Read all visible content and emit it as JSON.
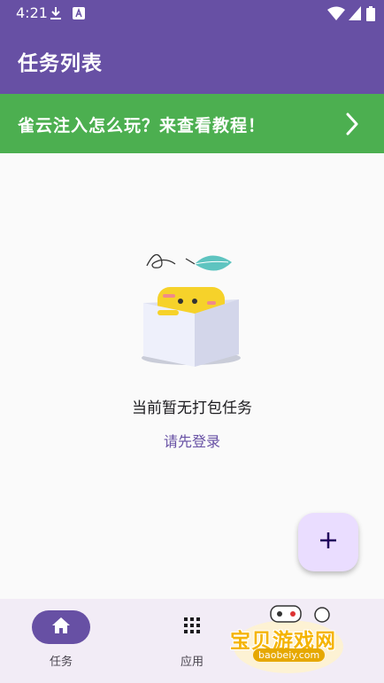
{
  "status_bar": {
    "time": "4:21",
    "icons": [
      "download-icon",
      "keyboard-a-icon",
      "wifi-icon",
      "signal-icon",
      "battery-icon"
    ]
  },
  "app_bar": {
    "title": "任务列表"
  },
  "banner": {
    "text": "雀云注入怎么玩？来查看教程！",
    "icon": "chevron-right-icon"
  },
  "empty_state": {
    "message": "当前暂无打包任务",
    "action_link": "请先登录",
    "illustration": "empty-box-illustration"
  },
  "fab": {
    "icon": "plus-icon"
  },
  "bottom_nav": {
    "items": [
      {
        "label": "任务",
        "icon": "home-icon",
        "active": true
      },
      {
        "label": "应用",
        "icon": "apps-grid-icon",
        "active": false
      }
    ]
  },
  "watermark": {
    "text": "宝贝游戏网",
    "url": "baobeiy.com"
  },
  "colors": {
    "primary": "#6750a4",
    "banner": "#4caf50",
    "fab_bg": "#eaddff",
    "nav_bg": "#f2ecf6",
    "background": "#fafafa"
  }
}
